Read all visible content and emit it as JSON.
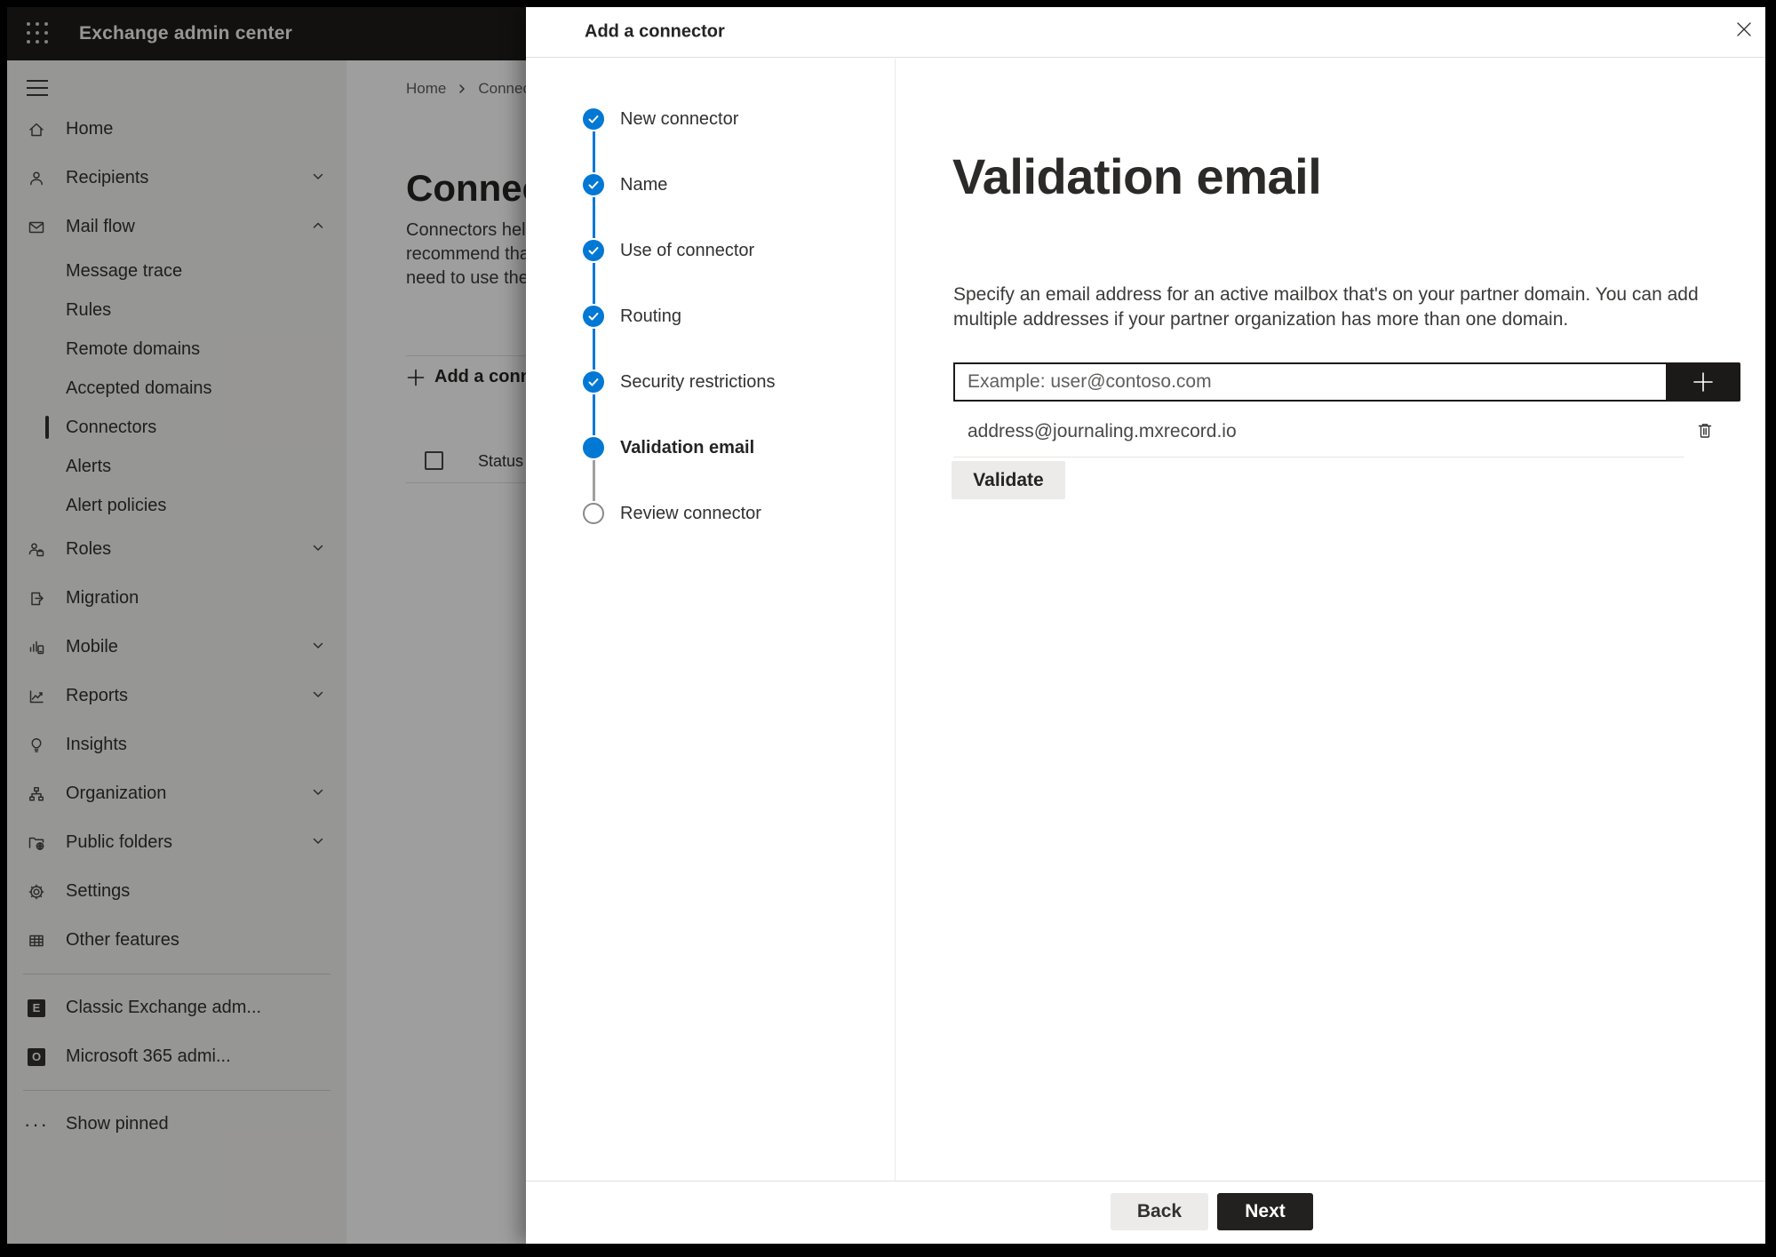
{
  "app": {
    "title": "Exchange admin center"
  },
  "sidebar": {
    "items": [
      {
        "label": "Home"
      },
      {
        "label": "Recipients"
      },
      {
        "label": "Mail flow"
      },
      {
        "label": "Message trace"
      },
      {
        "label": "Rules"
      },
      {
        "label": "Remote domains"
      },
      {
        "label": "Accepted domains"
      },
      {
        "label": "Connectors"
      },
      {
        "label": "Alerts"
      },
      {
        "label": "Alert policies"
      },
      {
        "label": "Roles"
      },
      {
        "label": "Migration"
      },
      {
        "label": "Mobile"
      },
      {
        "label": "Reports"
      },
      {
        "label": "Insights"
      },
      {
        "label": "Organization"
      },
      {
        "label": "Public folders"
      },
      {
        "label": "Settings"
      },
      {
        "label": "Other features"
      },
      {
        "label": "Classic Exchange adm..."
      },
      {
        "label": "Microsoft 365 admi..."
      },
      {
        "label": "Show pinned"
      }
    ]
  },
  "background": {
    "breadcrumb": {
      "home": "Home",
      "current": "Connectors"
    },
    "page_title": "Connectors",
    "description_lines": {
      "l1": "Connectors help",
      "l2": "recommend that",
      "l3": "need to use ther"
    },
    "add_button": "Add a connector",
    "table": {
      "status_column": "Status"
    }
  },
  "panel": {
    "title": "Add a connector",
    "steps": [
      {
        "label": "New connector",
        "state": "complete"
      },
      {
        "label": "Name",
        "state": "complete"
      },
      {
        "label": "Use of connector",
        "state": "complete"
      },
      {
        "label": "Routing",
        "state": "complete"
      },
      {
        "label": "Security restrictions",
        "state": "complete"
      },
      {
        "label": "Validation email",
        "state": "current"
      },
      {
        "label": "Review connector",
        "state": "upcoming"
      }
    ],
    "content": {
      "heading": "Validation email",
      "description": "Specify an email address for an active mailbox that's on your partner domain. You can add multiple addresses if your partner organization has more than one domain.",
      "email_input": {
        "value": "",
        "placeholder": "Example: user@contoso.com"
      },
      "addresses": [
        {
          "email": "address@journaling.mxrecord.io"
        }
      ],
      "validate_button": "Validate"
    },
    "footer": {
      "back_button": "Back",
      "next_button": "Next"
    }
  },
  "colors": {
    "accent": "#0078d4",
    "dark_button": "#1b1a19",
    "topbar": "#1d1c1b"
  }
}
